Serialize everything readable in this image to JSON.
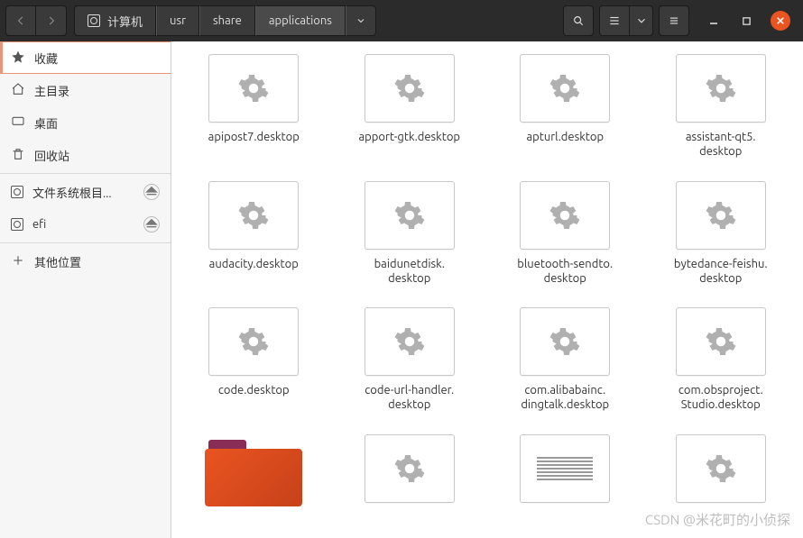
{
  "path": {
    "root_label": "计算机",
    "segments": [
      "usr",
      "share",
      "applications"
    ]
  },
  "sidebar": {
    "items": [
      {
        "label": "收藏",
        "icon": "star",
        "active": true
      },
      {
        "label": "主目录",
        "icon": "home"
      },
      {
        "label": "桌面",
        "icon": "desktop"
      },
      {
        "label": "回收站",
        "icon": "trash"
      }
    ],
    "mounts": [
      {
        "label": "文件系统根目...",
        "ejectable": true
      },
      {
        "label": "efi",
        "ejectable": true
      }
    ],
    "other_label": "其他位置"
  },
  "files": [
    {
      "label": "apipost7.desktop",
      "kind": "gear"
    },
    {
      "label": "apport-gtk.desktop",
      "kind": "gear"
    },
    {
      "label": "apturl.desktop",
      "kind": "gear"
    },
    {
      "label": "assistant-qt5.\ndesktop",
      "kind": "gear"
    },
    {
      "label": "audacity.desktop",
      "kind": "gear"
    },
    {
      "label": "baidunetdisk.\ndesktop",
      "kind": "gear"
    },
    {
      "label": "bluetooth-sendto.\ndesktop",
      "kind": "gear"
    },
    {
      "label": "bytedance-feishu.\ndesktop",
      "kind": "gear"
    },
    {
      "label": "code.desktop",
      "kind": "gear"
    },
    {
      "label": "code-url-handler.\ndesktop",
      "kind": "gear"
    },
    {
      "label": "com.alibabainc.\ndingtalk.desktop",
      "kind": "gear"
    },
    {
      "label": "com.obsproject.\nStudio.desktop",
      "kind": "gear"
    },
    {
      "label": "",
      "kind": "folder"
    },
    {
      "label": "",
      "kind": "gear"
    },
    {
      "label": "",
      "kind": "text"
    },
    {
      "label": "",
      "kind": "gear"
    }
  ],
  "watermark": "CSDN @米花町的小侦探"
}
